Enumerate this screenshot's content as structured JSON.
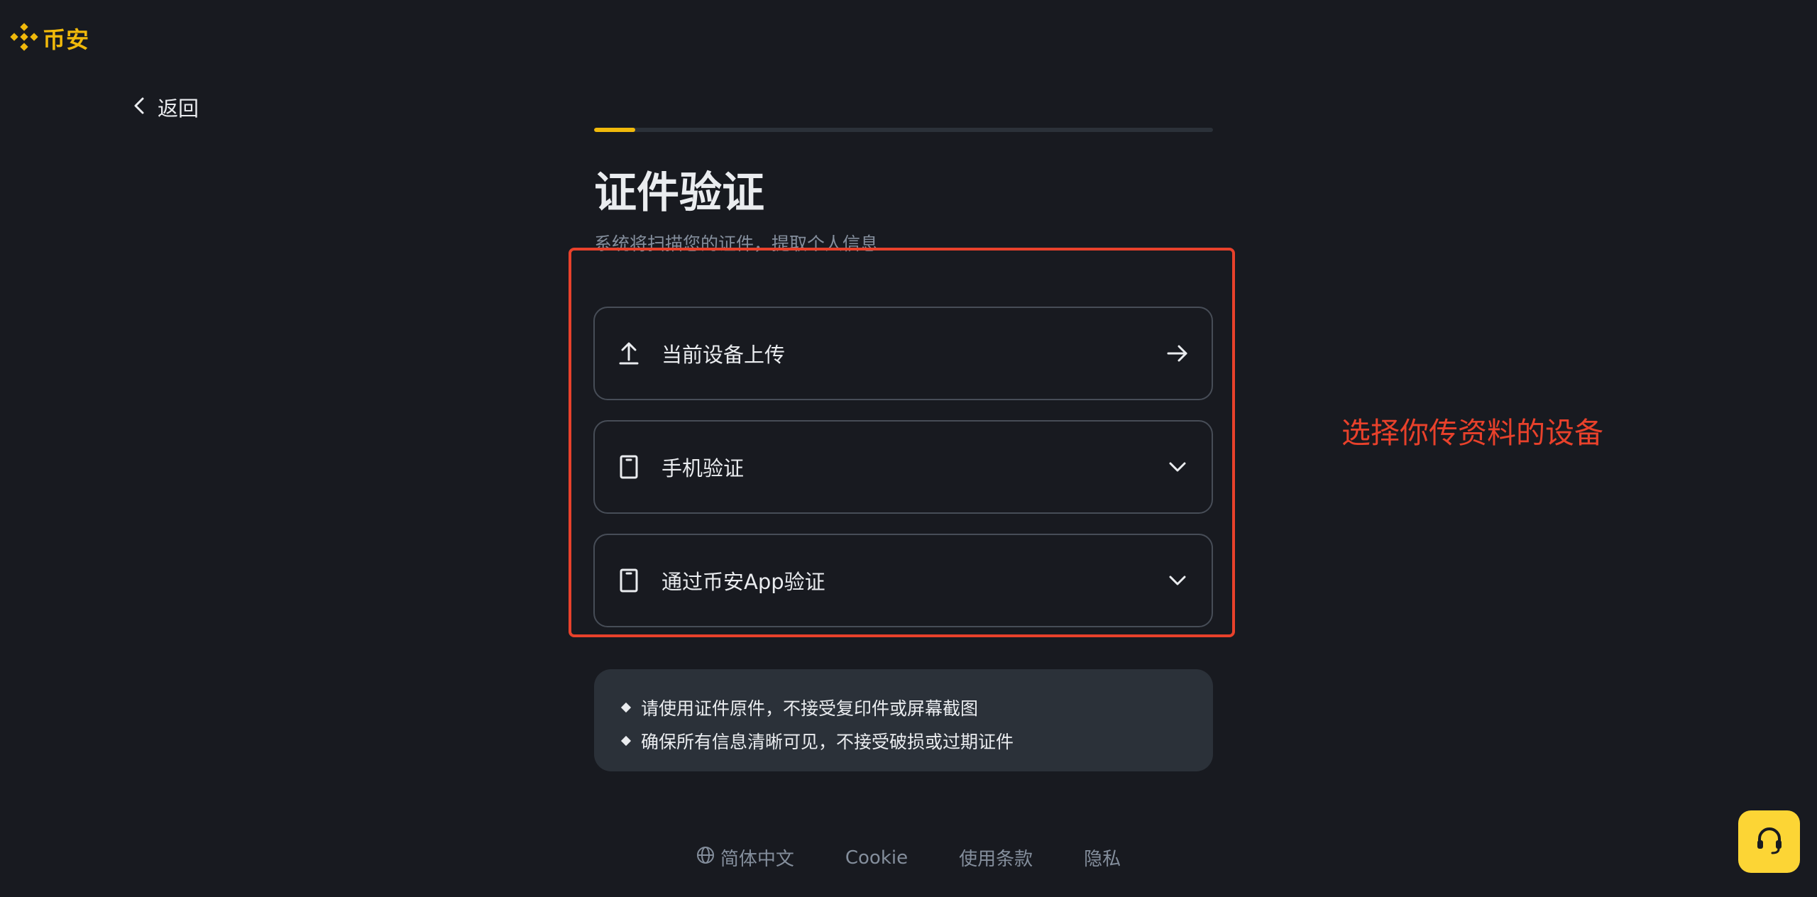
{
  "brand": {
    "name": "币安",
    "color": "#f0b90b"
  },
  "nav": {
    "back_label": "返回"
  },
  "progress": {
    "fraction": 0.067
  },
  "page": {
    "title": "证件验证",
    "subtitle": "系统将扫描您的证件，提取个人信息"
  },
  "options": [
    {
      "label": "当前设备上传",
      "icon": "upload-icon",
      "trail": "arrow-right-icon"
    },
    {
      "label": "手机验证",
      "icon": "phone-icon",
      "trail": "chevron-down-icon"
    },
    {
      "label": "通过币安App验证",
      "icon": "phone-icon",
      "trail": "chevron-down-icon"
    }
  ],
  "annotation": {
    "text": "选择你传资料的设备",
    "color": "#e8412b"
  },
  "tips": [
    "请使用证件原件，不接受复印件或屏幕截图",
    "确保所有信息清晰可见，不接受破损或过期证件"
  ],
  "footer": {
    "language": "简体中文",
    "cookie": "Cookie",
    "terms": "使用条款",
    "privacy": "隐私"
  },
  "colors": {
    "accent": "#f0b90b",
    "support_button": "#fcd535",
    "background": "#181a20"
  }
}
